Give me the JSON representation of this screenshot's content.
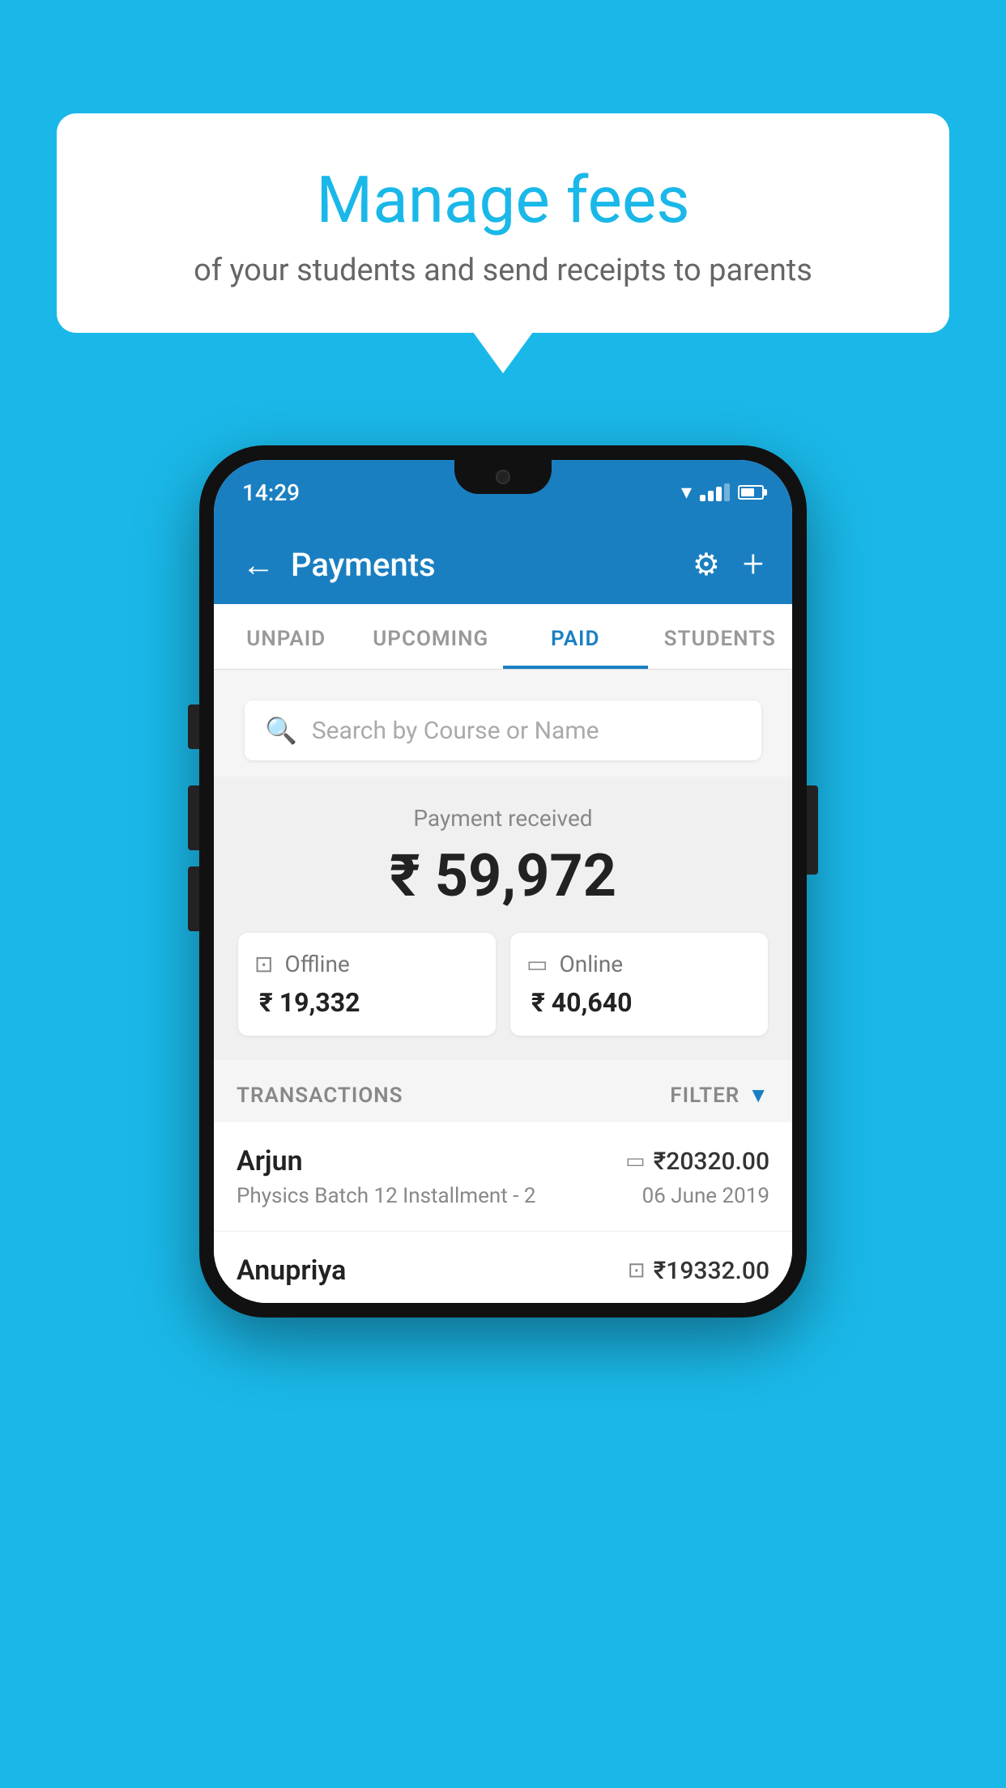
{
  "background_color": "#1ab8e8",
  "bubble": {
    "title": "Manage fees",
    "subtitle": "of your students and send receipts to parents"
  },
  "status_bar": {
    "time": "14:29"
  },
  "app_bar": {
    "title": "Payments",
    "back_label": "←",
    "gear_label": "⚙",
    "plus_label": "+"
  },
  "tabs": [
    {
      "label": "UNPAID",
      "active": false
    },
    {
      "label": "UPCOMING",
      "active": false
    },
    {
      "label": "PAID",
      "active": true
    },
    {
      "label": "STUDENTS",
      "active": false
    }
  ],
  "search": {
    "placeholder": "Search by Course or Name"
  },
  "payment_summary": {
    "label": "Payment received",
    "amount": "₹ 59,972",
    "offline_label": "Offline",
    "offline_amount": "₹ 19,332",
    "online_label": "Online",
    "online_amount": "₹ 40,640"
  },
  "transactions": {
    "header_label": "TRANSACTIONS",
    "filter_label": "FILTER",
    "rows": [
      {
        "name": "Arjun",
        "detail": "Physics Batch 12 Installment - 2",
        "amount": "₹20320.00",
        "date": "06 June 2019",
        "payment_type": "card"
      },
      {
        "name": "Anupriya",
        "detail": "",
        "amount": "₹19332.00",
        "date": "",
        "payment_type": "cash"
      }
    ]
  }
}
